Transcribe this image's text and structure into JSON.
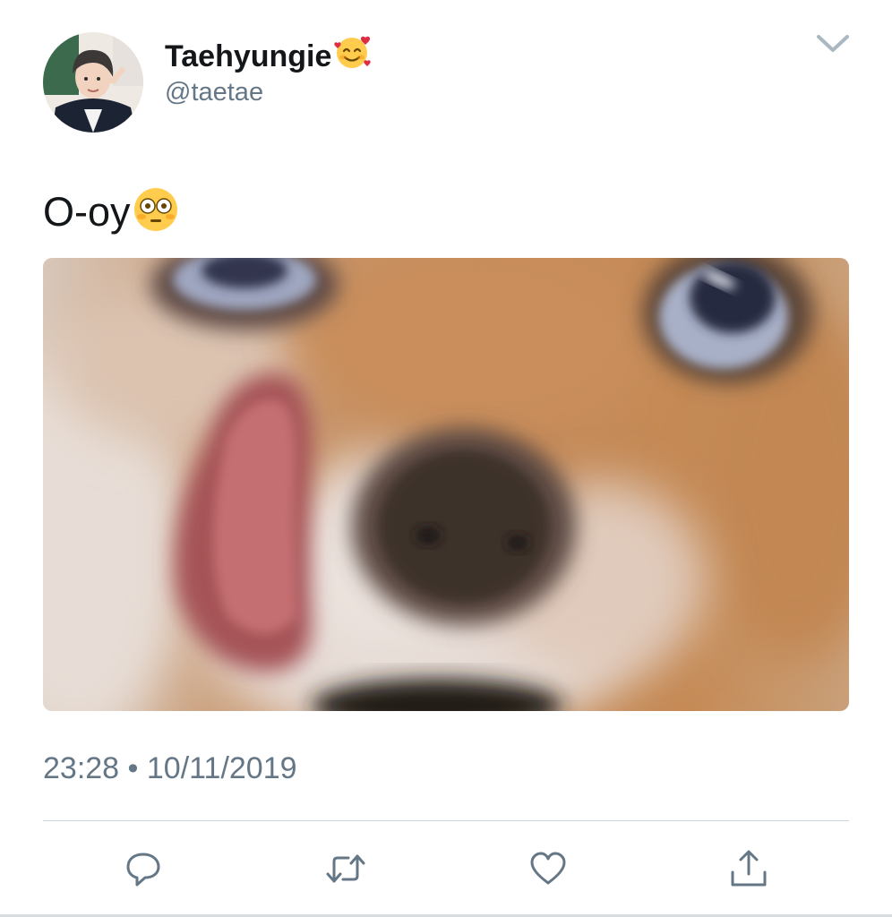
{
  "user": {
    "display_name": "Taehyungie",
    "display_name_emoji": "smiling-face-with-hearts",
    "handle": "@taetae",
    "avatar": "profile-photo"
  },
  "tweet": {
    "text": "O-oy",
    "text_emoji": "flushed-face",
    "media": "blurred close-up photo of a dog licking its nose",
    "timestamp": "23:28 • 10/11/2019"
  },
  "actions": [
    {
      "icon": "reply-icon"
    },
    {
      "icon": "retweet-icon"
    },
    {
      "icon": "like-icon"
    },
    {
      "icon": "share-icon"
    }
  ],
  "colors": {
    "text_primary": "#14171a",
    "text_secondary": "#657786",
    "icon_gray": "#657786",
    "divider": "#ccd6dd"
  }
}
